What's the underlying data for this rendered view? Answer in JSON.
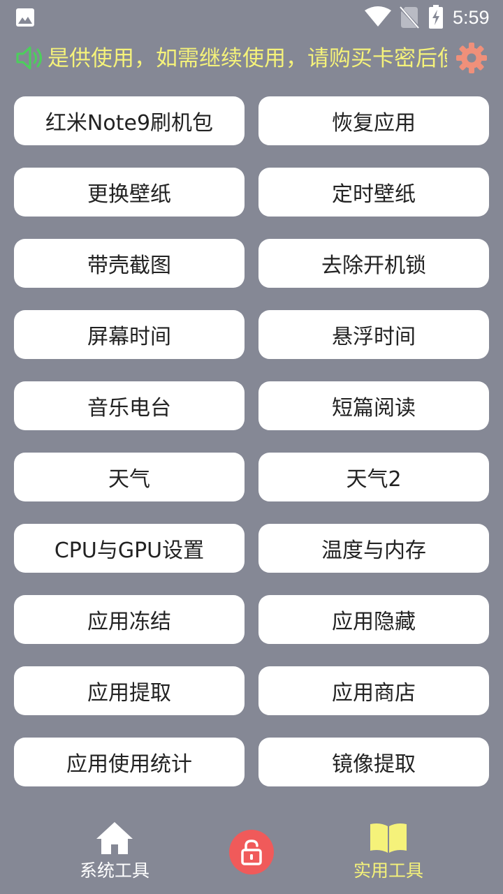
{
  "status_bar": {
    "time": "5:59"
  },
  "marquee": {
    "text": "是供使用，如需继续使用，请购买卡密后使用"
  },
  "tools": [
    {
      "label": "红米Note9刷机包"
    },
    {
      "label": "恢复应用"
    },
    {
      "label": "更换壁纸"
    },
    {
      "label": "定时壁纸"
    },
    {
      "label": "带壳截图"
    },
    {
      "label": "去除开机锁"
    },
    {
      "label": "屏幕时间"
    },
    {
      "label": "悬浮时间"
    },
    {
      "label": "音乐电台"
    },
    {
      "label": "短篇阅读"
    },
    {
      "label": "天气"
    },
    {
      "label": "天气2"
    },
    {
      "label": "CPU与GPU设置"
    },
    {
      "label": "温度与内存"
    },
    {
      "label": "应用冻结"
    },
    {
      "label": "应用隐藏"
    },
    {
      "label": "应用提取"
    },
    {
      "label": "应用商店"
    },
    {
      "label": "应用使用统计"
    },
    {
      "label": "镜像提取"
    }
  ],
  "bottom_nav": {
    "system_label": "系统工具",
    "practical_label": "实用工具"
  },
  "colors": {
    "background": "#858895",
    "accent_yellow": "#f5f27a",
    "speaker_green": "#4ccf5c",
    "settings_salmon": "#f0907a",
    "lock_red": "#f05a5a"
  },
  "icons": {
    "gallery": "gallery-icon",
    "wifi": "wifi-icon",
    "no_sim": "no-sim-icon",
    "battery": "battery-charging-icon",
    "speaker": "speaker-icon",
    "settings": "gear-icon",
    "home": "home-icon",
    "lock": "lock-icon",
    "book": "book-icon"
  }
}
